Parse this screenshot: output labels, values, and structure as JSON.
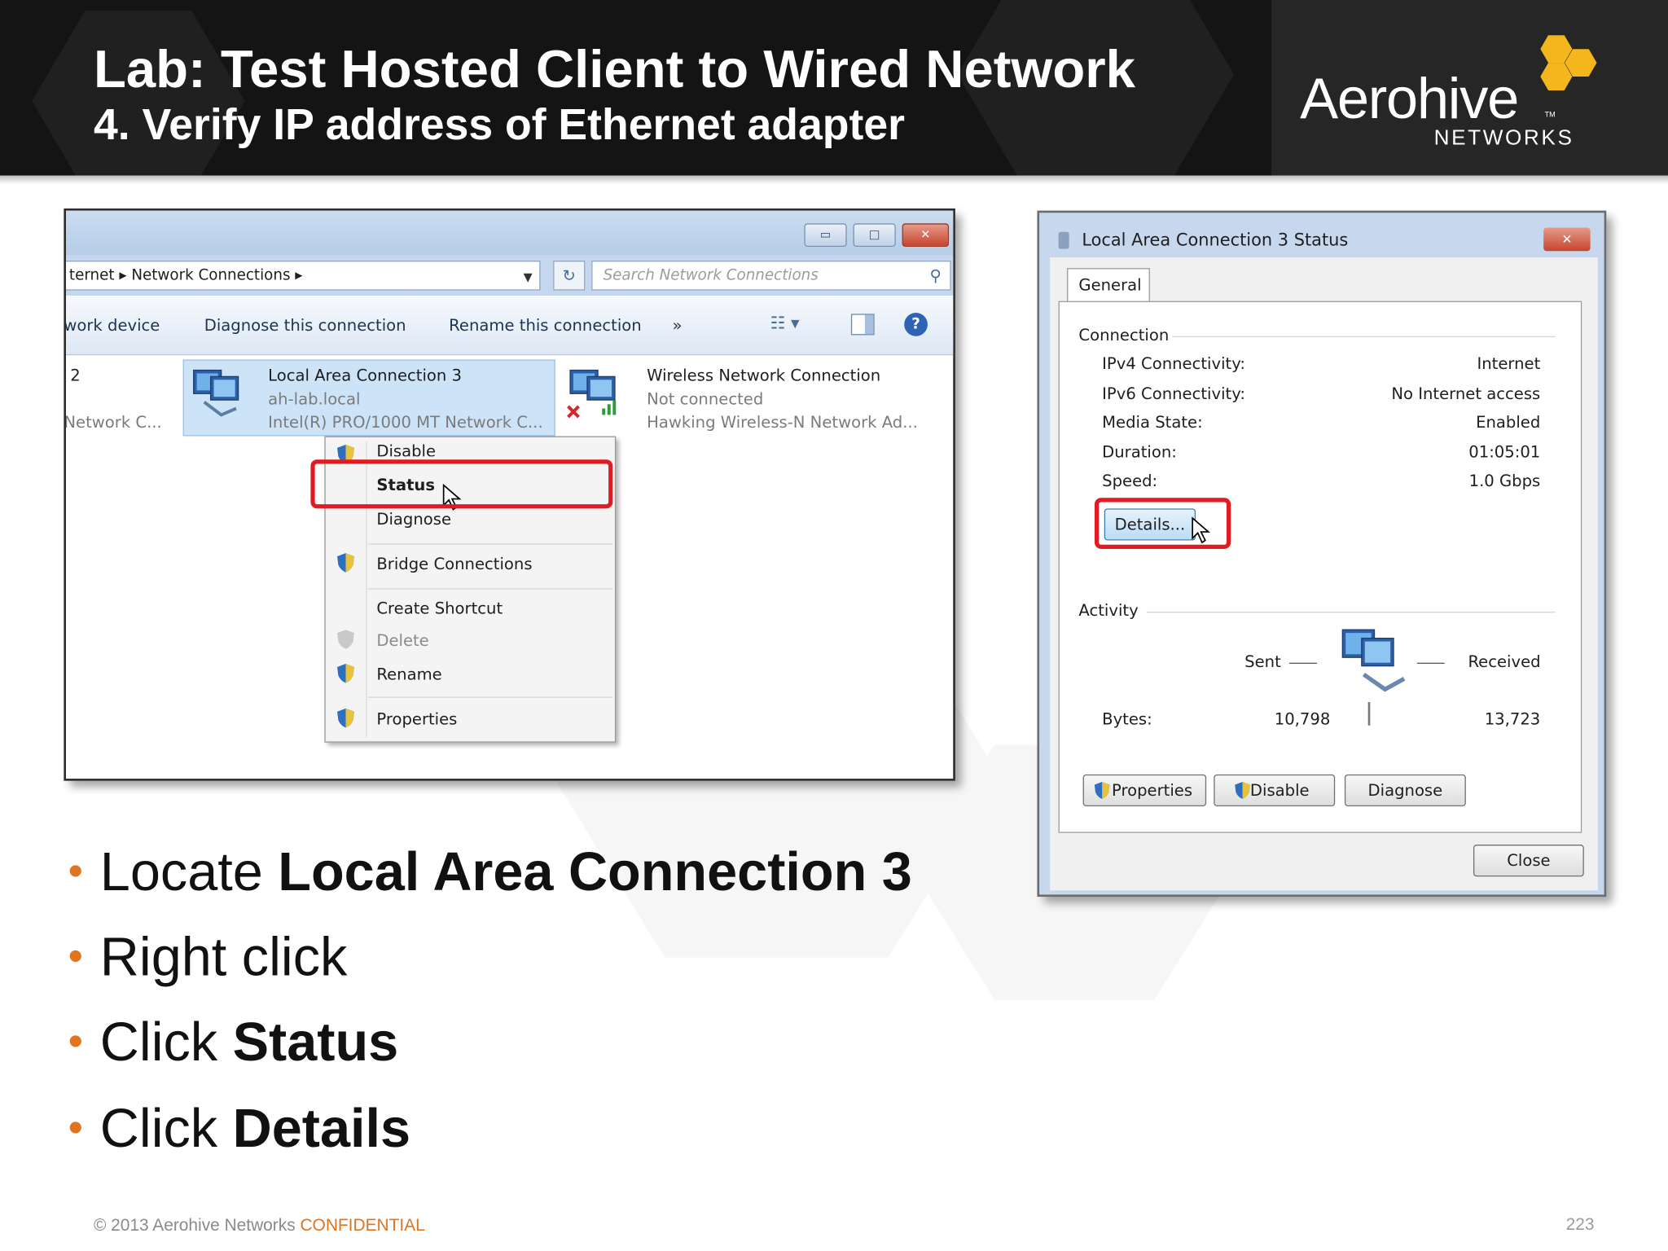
{
  "slide": {
    "title": "Lab: Test Hosted Client to Wired Network",
    "subtitle": "4. Verify IP address of Ethernet adapter",
    "logo": {
      "word": "Aerohive",
      "sub": "NETWORKS",
      "tm": "TM",
      "hex_color": "#f3b71d"
    }
  },
  "explorer": {
    "breadcrumb": "ternet  ▸  Network Connections  ▸",
    "search_placeholder": "Search Network Connections",
    "commands": [
      "work device",
      "Diagnose this connection",
      "Rename this connection",
      "»"
    ],
    "left_item": {
      "line1": "2",
      "line3": "Network C..."
    },
    "selected_item": {
      "name": "Local Area Connection 3",
      "domain": "ah-lab.local",
      "adapter": "Intel(R) PRO/1000 MT Network C..."
    },
    "wireless_item": {
      "name": "Wireless Network Connection",
      "status": "Not connected",
      "adapter": "Hawking Wireless-N Network Ad..."
    },
    "context_menu": {
      "disable": "Disable",
      "status": "Status",
      "diagnose": "Diagnose",
      "bridge": "Bridge Connections",
      "shortcut": "Create Shortcut",
      "delete": "Delete",
      "rename": "Rename",
      "properties": "Properties"
    }
  },
  "status_dialog": {
    "title": "Local Area Connection 3 Status",
    "tab": "General",
    "connection_label": "Connection",
    "rows": [
      {
        "label": "IPv4 Connectivity:",
        "value": "Internet"
      },
      {
        "label": "IPv6 Connectivity:",
        "value": "No Internet access"
      },
      {
        "label": "Media State:",
        "value": "Enabled"
      },
      {
        "label": "Duration:",
        "value": "01:05:01"
      },
      {
        "label": "Speed:",
        "value": "1.0 Gbps"
      }
    ],
    "details_button": "Details...",
    "activity_label": "Activity",
    "sent_label": "Sent",
    "received_label": "Received",
    "bytes_label": "Bytes:",
    "bytes_sent": "10,798",
    "bytes_received": "13,723",
    "buttons": {
      "properties": "Properties",
      "disable": "Disable",
      "diagnose": "Diagnose",
      "close": "Close"
    }
  },
  "bullets": [
    {
      "plain": "Locate ",
      "bold": "Local Area Connection 3"
    },
    {
      "plain": "Right click",
      "bold": ""
    },
    {
      "plain": "Click ",
      "bold": "Status"
    },
    {
      "plain": "Click ",
      "bold": "Details"
    }
  ],
  "footer": {
    "copyright": "© 2013 Aerohive Networks ",
    "confidential": "CONFIDENTIAL",
    "page": "223"
  },
  "colors": {
    "highlight": "#e11b22",
    "bullet": "#e0741f",
    "header_bg": "#141414"
  }
}
